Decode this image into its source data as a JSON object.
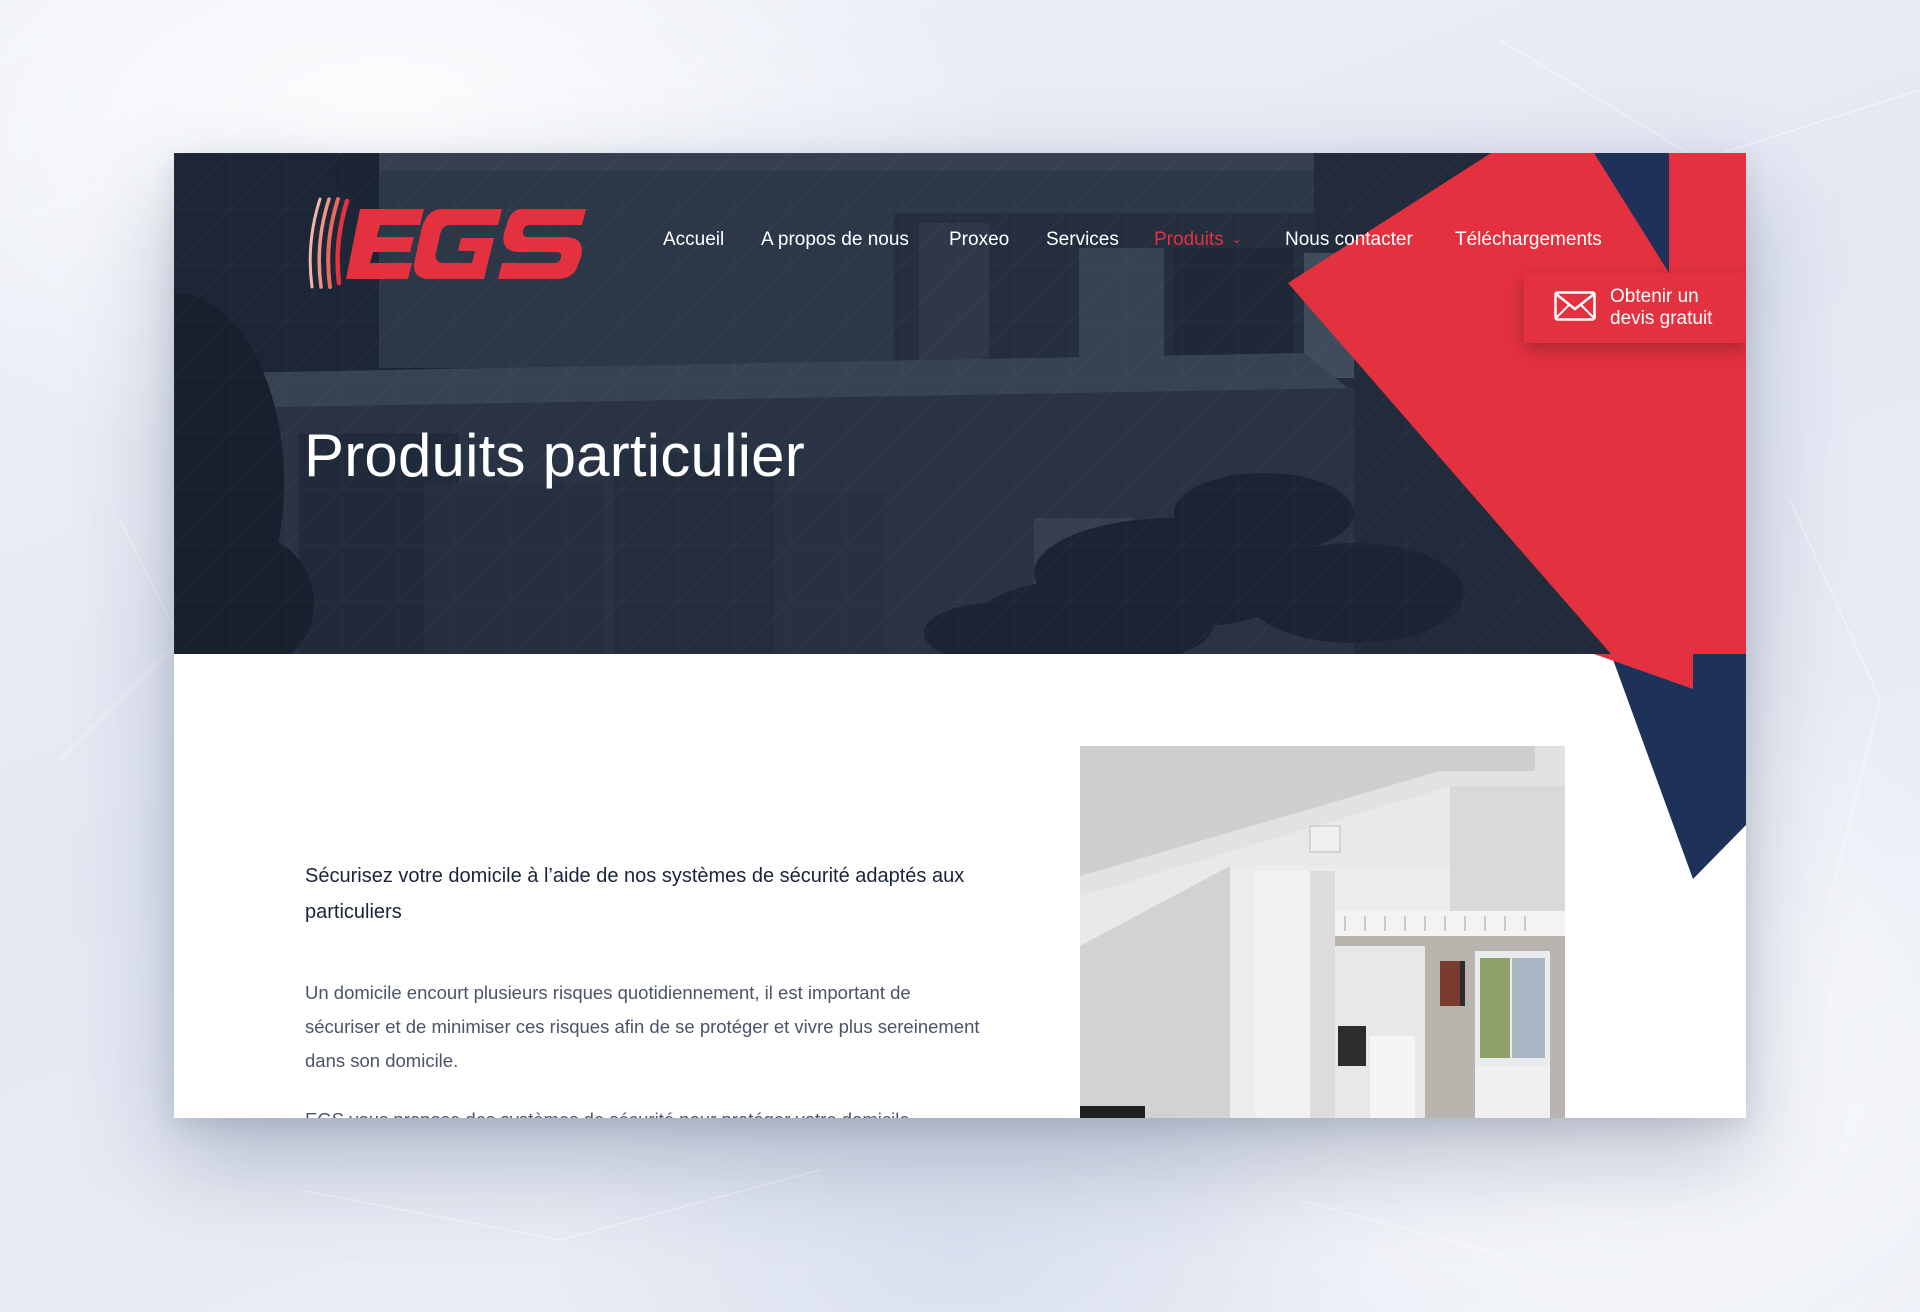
{
  "brand": {
    "logo_text": "EGS",
    "accent_color": "#e3313f",
    "navy_color": "#1e3259"
  },
  "nav": {
    "items": [
      {
        "label": "Accueil"
      },
      {
        "label": "A propos de nous"
      },
      {
        "label": "Proxeo"
      },
      {
        "label": "Services"
      },
      {
        "label": "Produits",
        "active": true,
        "has_dropdown": true
      },
      {
        "label": "Nous contacter"
      },
      {
        "label": "Téléchargements"
      }
    ]
  },
  "cta": {
    "line1": "Obtenir un",
    "line2": "devis gratuit",
    "icon": "envelope-icon"
  },
  "hero": {
    "title": "Produits particulier"
  },
  "content": {
    "lead": "Sécurisez votre domicile à l’aide de nos systèmes de sécurité adaptés aux particuliers",
    "paragraph": "Un domicile encourt plusieurs risques quotidiennement, il est important de sécuriser et de minimiser ces risques afin de se protéger et vivre plus sereinement dans son domicile.",
    "paragraph2": "EGS vous propose des systèmes de sécurité pour protéger votre domicile."
  }
}
